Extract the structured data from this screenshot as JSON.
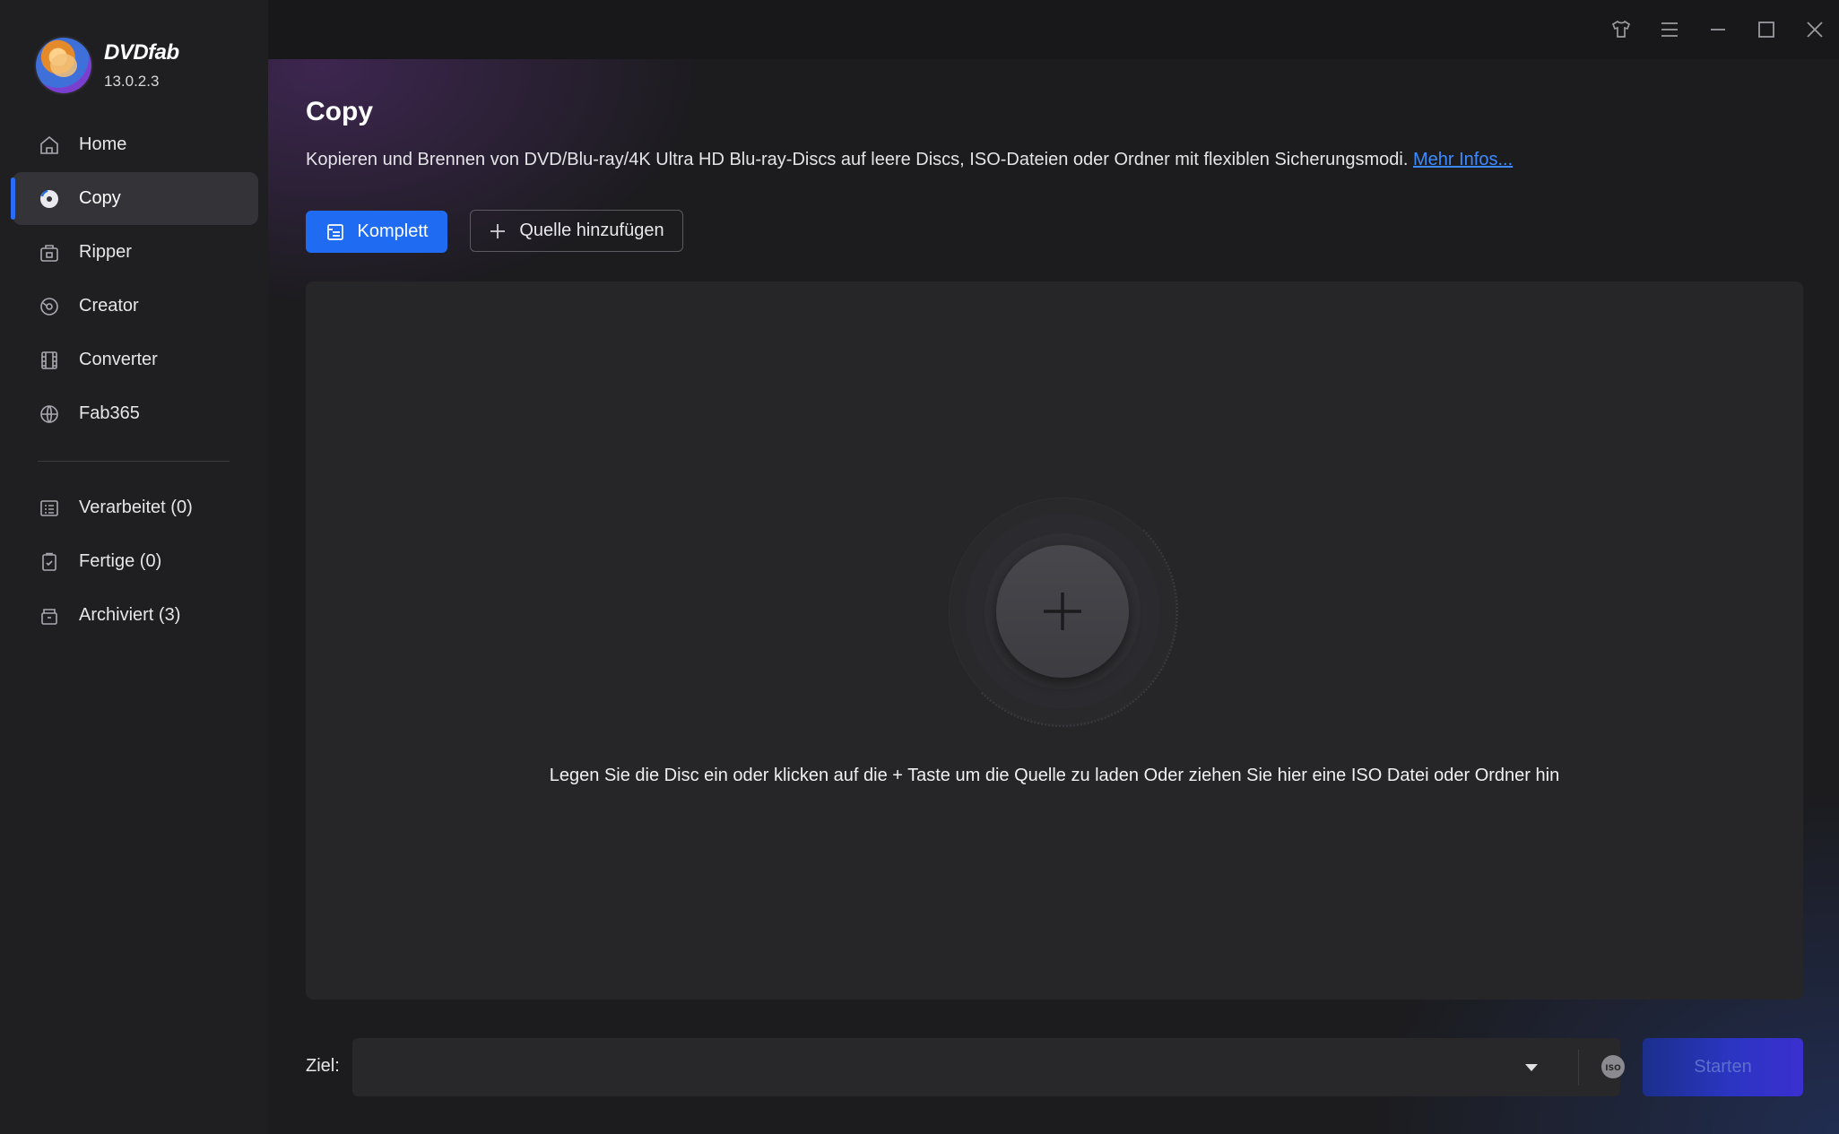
{
  "app": {
    "name": "DVDfab",
    "version": "13.0.2.3"
  },
  "sidebar": {
    "items": [
      {
        "label": "Home",
        "icon": "home-icon",
        "active": false
      },
      {
        "label": "Copy",
        "icon": "copy-disc-icon",
        "active": true
      },
      {
        "label": "Ripper",
        "icon": "ripper-icon",
        "active": false
      },
      {
        "label": "Creator",
        "icon": "creator-icon",
        "active": false
      },
      {
        "label": "Converter",
        "icon": "converter-film-icon",
        "active": false
      },
      {
        "label": "Fab365",
        "icon": "fab365-icon",
        "active": false
      }
    ],
    "queue": [
      {
        "label": "Verarbeitet (0)",
        "icon": "processing-list-icon"
      },
      {
        "label": "Fertige (0)",
        "icon": "finished-clipboard-icon"
      },
      {
        "label": "Archiviert (3)",
        "icon": "archive-box-icon"
      }
    ]
  },
  "titlebar": {
    "controls": [
      "shirt-skin-icon",
      "menu-icon",
      "minimize-icon",
      "maximize-icon",
      "close-icon"
    ]
  },
  "main": {
    "title": "Copy",
    "description": "Kopieren und Brennen von DVD/Blu-ray/4K Ultra HD Blu-ray-Discs auf leere Discs, ISO-Dateien oder Ordner mit flexiblen Sicherungsmodi.",
    "more_link": "Mehr Infos...",
    "mode_button": "Komplett",
    "add_source_button": "Quelle hinzufügen",
    "drop_hint": "Legen Sie die Disc ein oder klicken auf die + Taste um die Quelle zu laden Oder ziehen Sie hier eine ISO Datei oder Ordner hin"
  },
  "output": {
    "label": "Ziel:",
    "value": "",
    "start_button": "Starten"
  },
  "colors": {
    "accent": "#1f6cf2",
    "link": "#3d8bff",
    "sidebar_bg": "#1f1f22",
    "main_bg": "#1c1c1f",
    "dropzone_bg": "#262629"
  }
}
